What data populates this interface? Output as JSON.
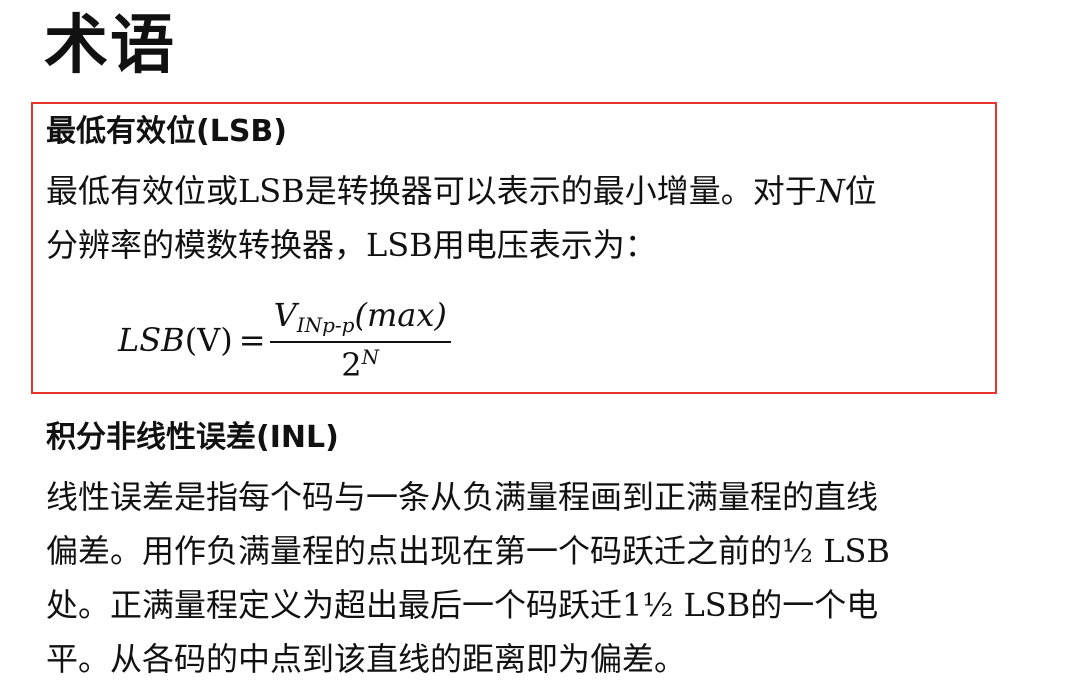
{
  "page": {
    "heading": "术语"
  },
  "lsb": {
    "title": "最低有效位(LSB)",
    "lines": [
      {
        "before": "最低有效位或LSB是转换器可以表示的最小增量。对于",
        "var": "N",
        "after": "位"
      },
      "分辨率的模数转换器，LSB用电压表示为："
    ],
    "formula": {
      "lhs_italic": "LSB",
      "lhs_unit": "(V)",
      "equals": "=",
      "numerator_var": "V",
      "numerator_sub": "INp-p",
      "numerator_arg": "(max)",
      "denominator_base": "2",
      "denominator_exp": "N"
    }
  },
  "inl": {
    "title": "积分非线性误差(INL)",
    "lines": [
      "线性误差是指每个码与一条从负满量程画到正满量程的直线",
      "偏差。用作负满量程的点出现在第一个码跃迁之前的½ LSB",
      "处。正满量程定义为超出最后一个码跃迁1½ LSB的一个电",
      "平。从各码的中点到该直线的距离即为偏差。"
    ]
  },
  "colors": {
    "highlight_border": "#e8332d",
    "text": "#111111"
  }
}
